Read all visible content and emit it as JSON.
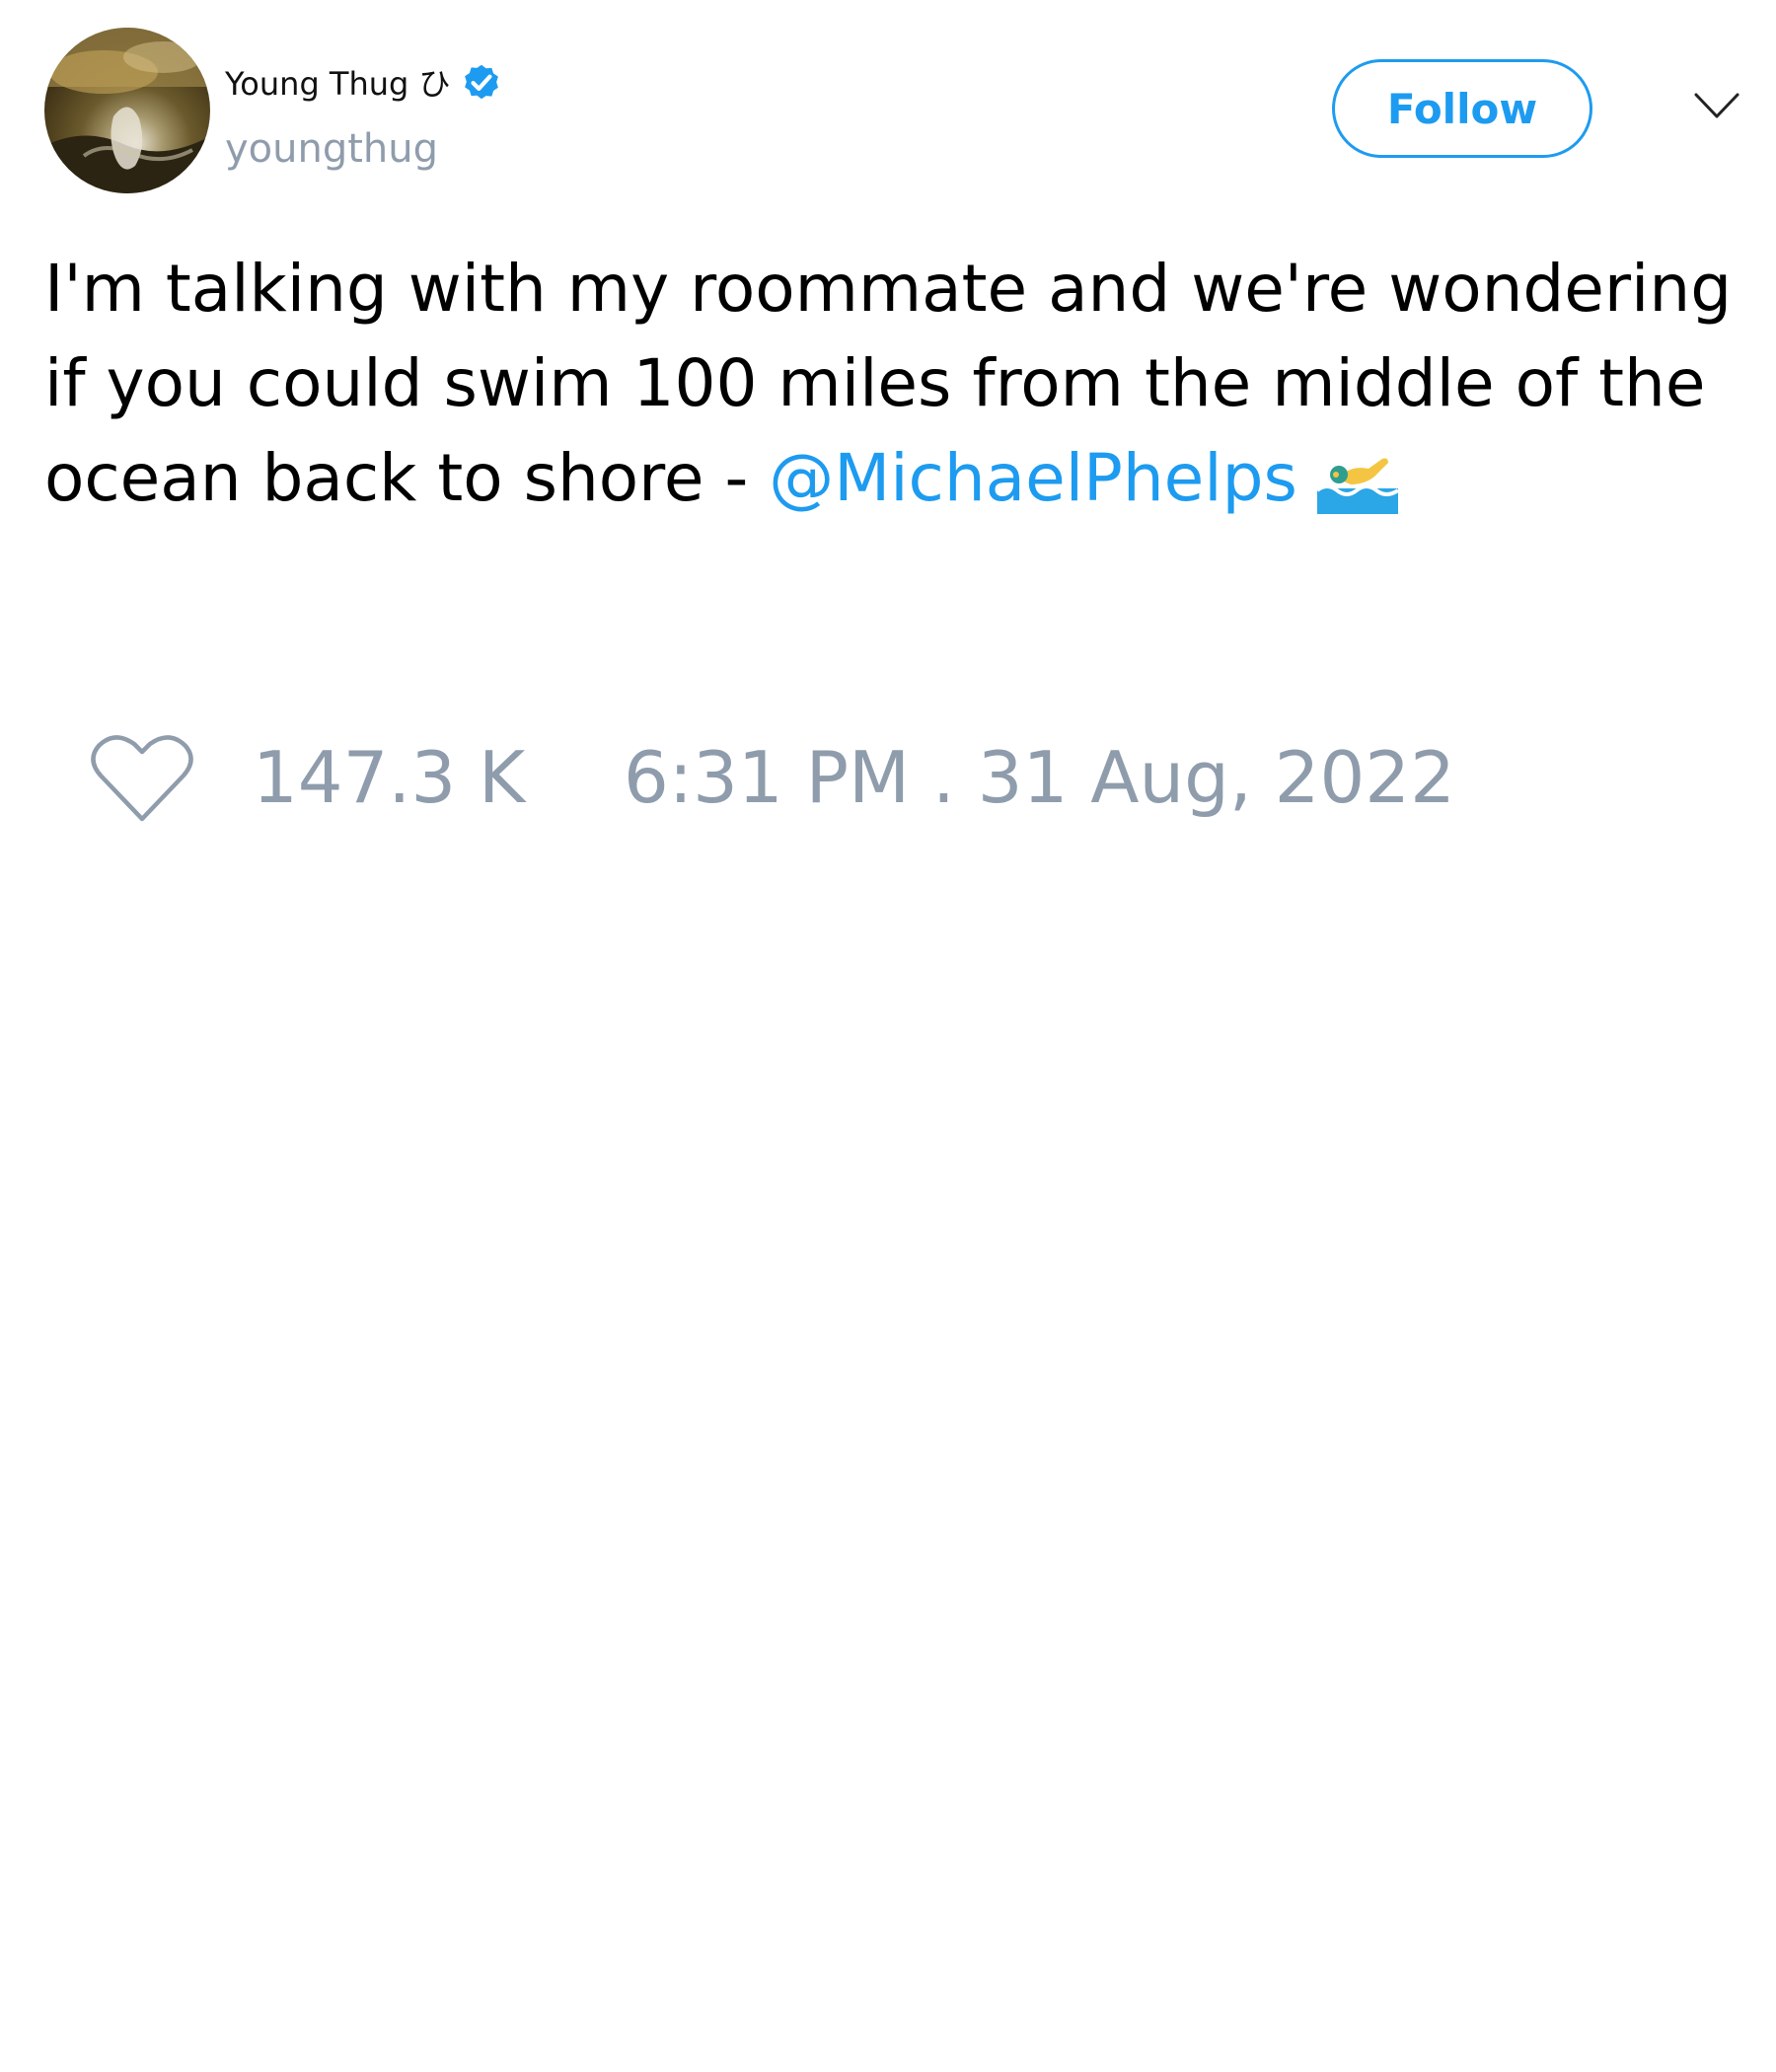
{
  "author": {
    "display_name": "Young Thug ひ",
    "handle": "youngthug",
    "verified_icon": "verified-badge-icon",
    "avatar": "profile-photo"
  },
  "actions": {
    "follow_label": "Follow",
    "menu_icon": "chevron-down-icon"
  },
  "tweet": {
    "text": "I'm talking with my roommate and we're wondering if you could swim 100 miles from the middle of the ocean back to shore - ",
    "mention": "@MichaelPhelps",
    "emoji_icon": "swimmer-emoji-icon"
  },
  "stats": {
    "like_icon": "heart-icon",
    "likes": "147.3 K",
    "timestamp": "6:31 PM . 31 Aug, 2022"
  },
  "colors": {
    "accent": "#1d9bf0",
    "muted": "#8f9cac",
    "text": "#000000",
    "background": "#ffffff"
  }
}
